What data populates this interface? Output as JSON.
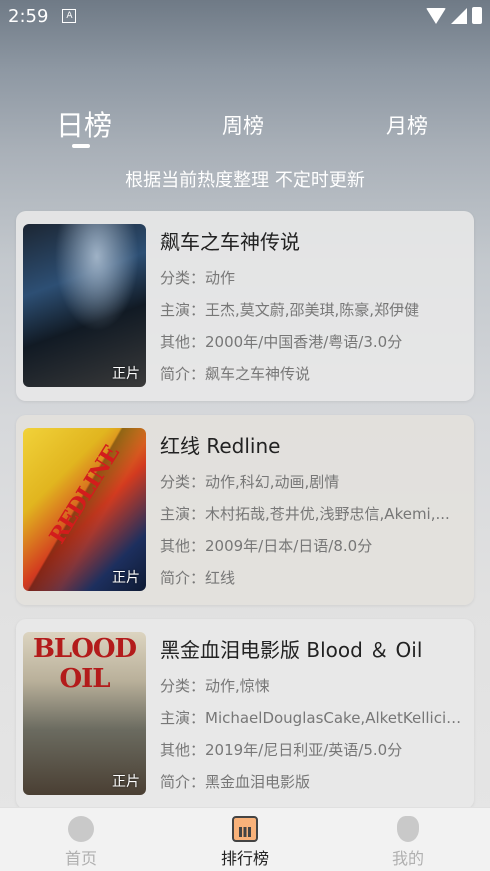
{
  "status_bar": {
    "time": "2:59",
    "app_icon": "A"
  },
  "tabs": [
    {
      "label": "日榜",
      "active": true
    },
    {
      "label": "周榜",
      "active": false
    },
    {
      "label": "月榜",
      "active": false
    }
  ],
  "subtitle": "根据当前热度整理 不定时更新",
  "movies": [
    {
      "title": "飙车之车神传说",
      "category": "分类：动作",
      "cast": "主演：王杰,莫文蔚,邵美琪,陈豪,郑伊健",
      "other": "其他：2000年/中国香港/粤语/3.0分",
      "intro": "简介：飙车之车神传说",
      "badge": "正片"
    },
    {
      "title": "红线 Redline",
      "category": "分类：动作,科幻,动画,剧情",
      "cast": "主演：木村拓哉,苍井优,浅野忠信,Akemi,...",
      "other": "其他：2009年/日本/日语/8.0分",
      "intro": "简介：红线",
      "badge": "正片",
      "poster_art": "REDLINE"
    },
    {
      "title": "黑金血泪电影版 Blood ＆ Oil",
      "category": "分类：动作,惊悚",
      "cast": "主演：MichaelDouglasCake,AlketKellici,...",
      "other": "其他：2019年/尼日利亚/英语/5.0分",
      "intro": "简介：黑金血泪电影版",
      "badge": "正片",
      "poster_art": "BLOOD OIL"
    }
  ],
  "bottom_nav": [
    {
      "label": "首页",
      "icon": "home-icon",
      "active": false
    },
    {
      "label": "排行榜",
      "icon": "ranking-icon",
      "active": true
    },
    {
      "label": "我的",
      "icon": "profile-icon",
      "active": false
    }
  ],
  "colors": {
    "active_text": "#222222",
    "inactive_nav": "#b0b0b0",
    "card_bg": "#e8e8e8"
  }
}
